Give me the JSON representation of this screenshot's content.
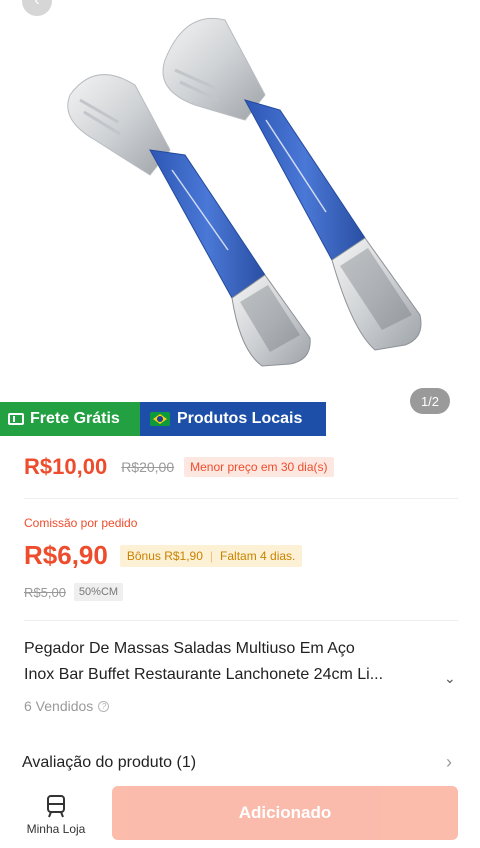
{
  "gallery": {
    "counter": "1/2",
    "image_alt": "Pegador de massas em aço inox com cabo azul"
  },
  "badges": {
    "free_shipping": "Frete Grátis",
    "local_products": "Produtos Locais"
  },
  "price": {
    "current": "R$10,00",
    "original": "R$20,00",
    "tag": "Menor preço em 30 dia(s)"
  },
  "commission": {
    "label": "Comissão por pedido",
    "value": "R$6,90",
    "bonus": "Bônus R$1,90",
    "remaining": "Faltam 4 dias.",
    "old_value": "R$5,00",
    "percent": "50%CM"
  },
  "product": {
    "title_line1": "Pegador De Massas Saladas Multiuso Em Aço",
    "title_line2": "Inox Bar Buffet Restaurante Lanchonete 24cm Li...",
    "sold": "6 Vendidos"
  },
  "rating": {
    "label": "Avaliação do produto (1)"
  },
  "bottom": {
    "store_label": "Minha Loja",
    "add_label": "Adicionado"
  },
  "colors": {
    "accent": "#ee4d2d",
    "free_shipping_bg": "#23a142",
    "local_bg": "#1d4fa8",
    "button_disabled": "#fbb8a8"
  }
}
